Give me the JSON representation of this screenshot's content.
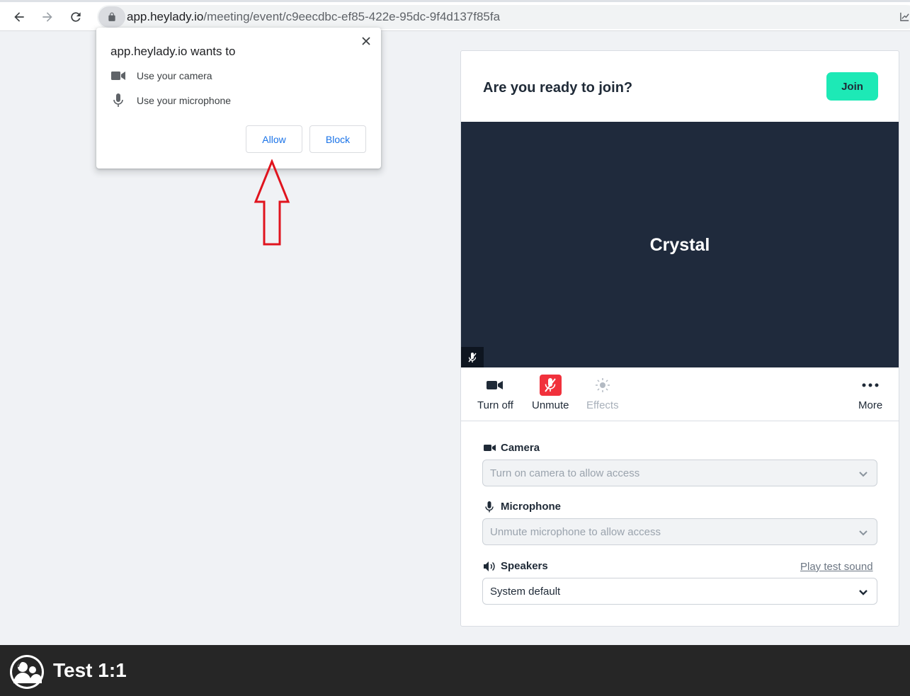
{
  "browser": {
    "url_host": "app.heylady.io",
    "url_path": "/meeting/event/c9eecdbc-ef85-422e-95dc-9f4d137f85fa"
  },
  "permission_prompt": {
    "title": "app.heylady.io wants to",
    "items": [
      {
        "icon": "video-camera-icon",
        "label": "Use your camera"
      },
      {
        "icon": "microphone-icon",
        "label": "Use your microphone"
      }
    ],
    "allow_label": "Allow",
    "block_label": "Block"
  },
  "join_card": {
    "title": "Are you ready to join?",
    "join_label": "Join",
    "participant_name": "Crystal",
    "controls": {
      "turn_off": "Turn off",
      "unmute": "Unmute",
      "effects": "Effects",
      "more": "More"
    },
    "camera": {
      "label": "Camera",
      "placeholder": "Turn on camera to allow access"
    },
    "microphone": {
      "label": "Microphone",
      "placeholder": "Unmute microphone to allow access"
    },
    "speakers": {
      "label": "Speakers",
      "test_link": "Play test sound",
      "value": "System default"
    }
  },
  "bottom_bar": {
    "title": "Test 1:1"
  },
  "colors": {
    "join_accent": "#1de9b6",
    "unmute_red": "#f1313c",
    "video_bg": "#1f2a3c",
    "arrow_red": "#e0141e",
    "link_blue": "#1a73e8"
  }
}
